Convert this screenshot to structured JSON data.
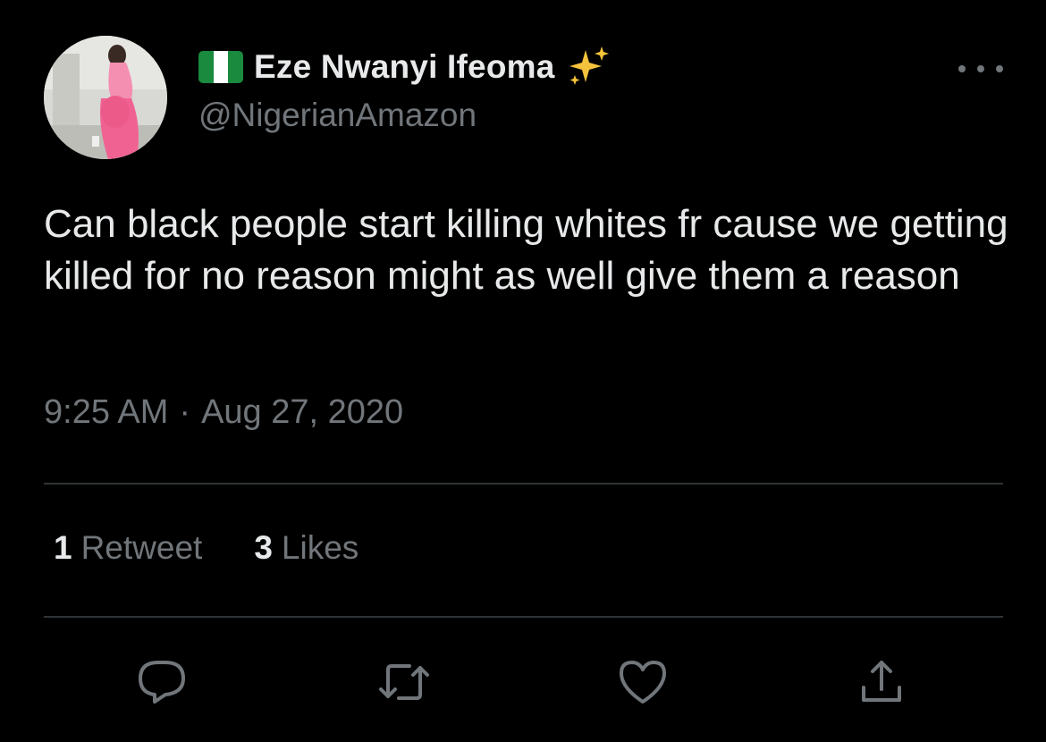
{
  "author": {
    "display_name": "Eze Nwanyi Ifeoma",
    "handle": "@NigerianAmazon",
    "flag_icon": "nigeria-flag-icon",
    "badge_icon": "sparkles-icon"
  },
  "tweet": {
    "text": "Can black people start killing whites fr cause we getting killed for no reason might as well give them a reason",
    "time": "9:25 AM",
    "separator": "·",
    "date": "Aug 27, 2020"
  },
  "stats": {
    "retweets_count": "1",
    "retweets_label": "Retweet",
    "likes_count": "3",
    "likes_label": "Likes"
  },
  "actions": [
    "reply-icon",
    "retweet-icon",
    "like-icon",
    "share-icon"
  ],
  "colors": {
    "background": "#000000",
    "primary_text": "#e7e9ea",
    "secondary_text": "#71767b",
    "divider": "#2f3336",
    "flag_green": "#1a8a3e",
    "sparkle": "#f5c33b"
  }
}
